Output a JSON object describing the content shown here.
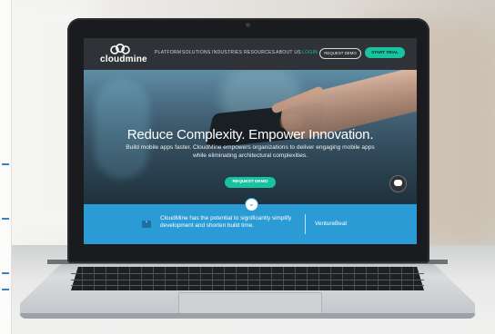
{
  "site": {
    "logo_text": "cloudmine",
    "nav": [
      "PLATFORM",
      "SOLUTIONS",
      "INDUSTRIES",
      "RESOURCES",
      "ABOUT US",
      "LOGIN"
    ],
    "request_demo_nav": "REQUEST DEMO",
    "start_trial": "START TRIAL"
  },
  "hero": {
    "headline": "Reduce Complexity. Empower Innovation.",
    "subheadline": "Build mobile apps faster. CloudMine empowers organizations to deliver engaging mobile apps while eliminating architectural complexities.",
    "cta": "REQUEST DEMO"
  },
  "testimonial": {
    "quote": "CloudMine has the potential to significantly simplify development and shorten build time.",
    "source": "VentureBeat"
  },
  "colors": {
    "accent": "#18c3a0",
    "band": "#2b9bd6",
    "nav_bg": "#2f3337"
  },
  "icons": [
    "cloud-logo-icon",
    "chevron-down-icon",
    "chat-icon",
    "quote-icon"
  ]
}
